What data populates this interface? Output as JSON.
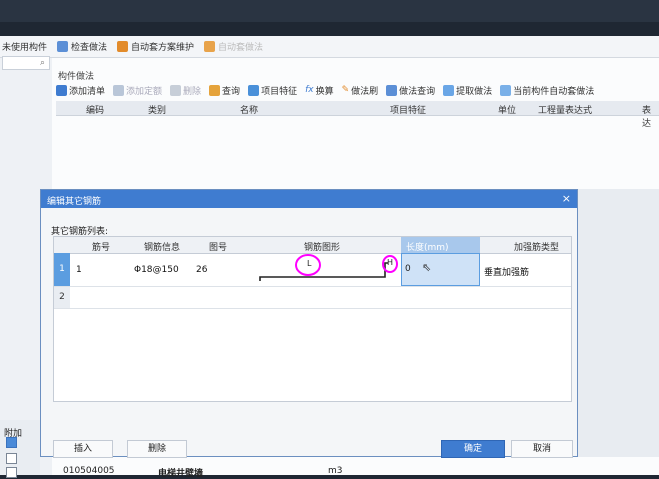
{
  "toolbar1": {
    "items": [
      "未使用构件",
      "检查做法",
      "自动套方案维护",
      "自动套做法"
    ]
  },
  "left": {
    "search_icon": "search-icon",
    "bottom_label": "附加"
  },
  "main": {
    "section_title": "构件做法",
    "toolbar2": {
      "add_list": "添加清单",
      "add_quota": "添加定额",
      "delete": "删除",
      "query": "查询",
      "item_feature": "项目特征",
      "convert": "换算",
      "method_brush": "做法刷",
      "method_query": "做法查询",
      "extract_method": "提取做法",
      "auto_method": "当前构件自动套做法"
    },
    "columns": [
      "编码",
      "类别",
      "名称",
      "项目特征",
      "单位",
      "工程量表达式",
      "表达"
    ]
  },
  "dialog": {
    "title": "编辑其它钢筋",
    "subtitle": "其它钢筋列表:",
    "columns": [
      "筋号",
      "钢筋信息",
      "图号",
      "钢筋图形",
      "长度(mm)",
      "加强筋类型"
    ],
    "rows": [
      {
        "index": "1",
        "bar_no": "1",
        "bar_info": "Φ18@150",
        "fig_no": "26",
        "shape_l": "L",
        "shape_h": "H",
        "length": "0",
        "type": "垂直加强筋"
      },
      {
        "index": "2",
        "bar_no": "",
        "bar_info": "",
        "fig_no": "",
        "length": "",
        "type": ""
      }
    ],
    "buttons": {
      "insert": "插入",
      "delete": "删除",
      "ok": "确定",
      "cancel": "取消"
    },
    "close": "×"
  },
  "footer": {
    "code": "010504005",
    "name": "电梯井壁墙",
    "unit": "m3"
  },
  "colors": {
    "accent": "#3f7cd0",
    "selection": "#5b9de0",
    "annotation": "#ff00ff"
  }
}
